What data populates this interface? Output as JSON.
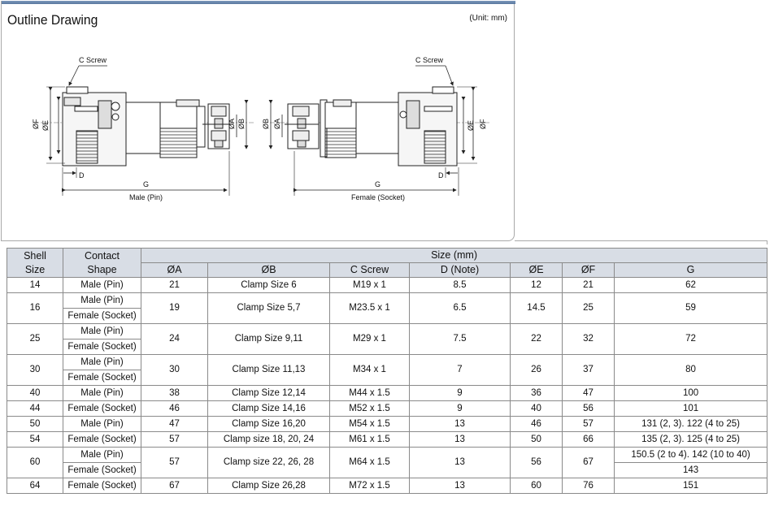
{
  "drawing": {
    "title": "Outline Drawing",
    "unit": "(Unit: mm)",
    "left_label": "Male (Pin)",
    "right_label": "Female (Socket)",
    "dim": {
      "c_screw": "C Screw",
      "g": "G",
      "d": "D",
      "phi_f": "ØF",
      "phi_e": "ØE",
      "phi_b": "ØB",
      "phi_a": "ØA"
    }
  },
  "table": {
    "headers": {
      "shell_size": [
        "Shell",
        "Size"
      ],
      "contact_shape": [
        "Contact",
        "Shape"
      ],
      "size_group": "Size (mm)",
      "a": "ØA",
      "b": "ØB",
      "c": "C Screw",
      "d": "D (Note)",
      "e": "ØE",
      "f": "ØF",
      "g": "G"
    },
    "rows": [
      {
        "shell": "14",
        "shapes": [
          "Male (Pin)"
        ],
        "a": "21",
        "b": "Clamp Size 6",
        "c": "M19 x 1",
        "d": "8.5",
        "e": "12",
        "f": "21",
        "g": [
          "62"
        ]
      },
      {
        "shell": "16",
        "shapes": [
          "Male (Pin)",
          "Female (Socket)"
        ],
        "a": "19",
        "b": "Clamp Size 5,7",
        "c": "M23.5 x 1",
        "d": "6.5",
        "e": "14.5",
        "f": "25",
        "g": [
          "59"
        ]
      },
      {
        "shell": "25",
        "shapes": [
          "Male (Pin)",
          "Female (Socket)"
        ],
        "a": "24",
        "b": "Clamp Size 9,11",
        "c": "M29 x 1",
        "d": "7.5",
        "e": "22",
        "f": "32",
        "g": [
          "72"
        ]
      },
      {
        "shell": "30",
        "shapes": [
          "Male (Pin)",
          "Female (Socket)"
        ],
        "a": "30",
        "b": "Clamp Size 11,13",
        "c": "M34 x 1",
        "d": "7",
        "e": "26",
        "f": "37",
        "g": [
          "80"
        ]
      },
      {
        "shell": "40",
        "shapes": [
          "Male (Pin)"
        ],
        "a": "38",
        "b": "Clamp Size 12,14",
        "c": "M44 x 1.5",
        "d": "9",
        "e": "36",
        "f": "47",
        "g": [
          "100"
        ]
      },
      {
        "shell": "44",
        "shapes": [
          "Female (Socket)"
        ],
        "a": "46",
        "b": "Clamp Size 14,16",
        "c": "M52 x 1.5",
        "d": "9",
        "e": "40",
        "f": "56",
        "g": [
          "101"
        ]
      },
      {
        "shell": "50",
        "shapes": [
          "Male (Pin)"
        ],
        "a": "47",
        "b": "Clamp Size 16,20",
        "c": "M54 x 1.5",
        "d": "13",
        "e": "46",
        "f": "57",
        "g": [
          "131 (2, 3). 122 (4 to 25)"
        ]
      },
      {
        "shell": "54",
        "shapes": [
          "Female (Socket)"
        ],
        "a": "57",
        "b": "Clamp size 18, 20, 24",
        "c": "M61 x 1.5",
        "d": "13",
        "e": "50",
        "f": "66",
        "g": [
          "135 (2, 3). 125 (4 to 25)"
        ]
      },
      {
        "shell": "60",
        "shapes": [
          "Male (Pin)",
          "Female (Socket)"
        ],
        "a": "57",
        "b": "Clamp size 22, 26, 28",
        "c": "M64 x 1.5",
        "d": "13",
        "e": "56",
        "f": "67",
        "g": [
          "150.5 (2 to 4). 142 (10 to 40)",
          "143"
        ]
      },
      {
        "shell": "64",
        "shapes": [
          "Female (Socket)"
        ],
        "a": "67",
        "b": "Clamp Size 26,28",
        "c": "M72 x 1.5",
        "d": "13",
        "e": "60",
        "f": "76",
        "g": [
          "151"
        ]
      }
    ]
  }
}
